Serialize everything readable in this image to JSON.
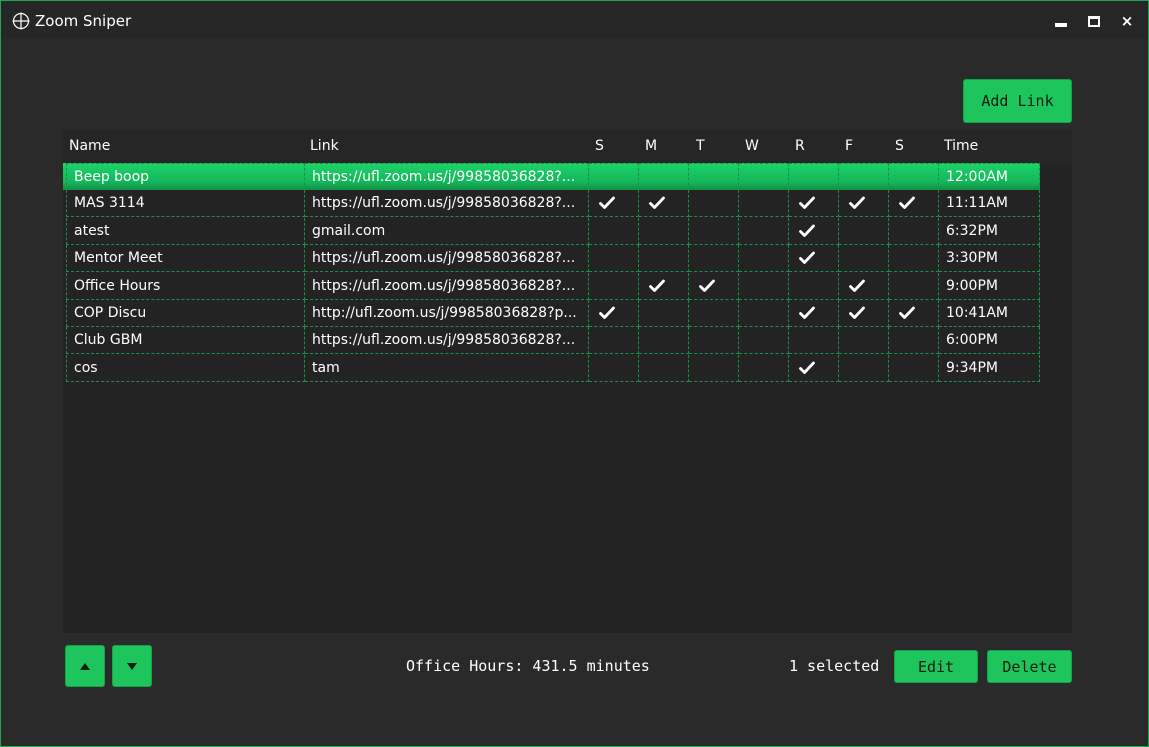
{
  "window": {
    "title": "Zoom Sniper",
    "app_icon": "crosshair-icon",
    "controls": {
      "minimize": "minimize-icon",
      "maximize": "maximize-icon",
      "close": "×"
    },
    "accent_color": "#1ec45c"
  },
  "toolbar": {
    "add_link_label": "Add Link"
  },
  "table": {
    "columns": [
      "Name",
      "Link",
      "S",
      "M",
      "T",
      "W",
      "R",
      "F",
      "S",
      "Time"
    ],
    "rows": [
      {
        "name": "Beep boop",
        "link": "https://ufl.zoom.us/j/99858036828?...",
        "days": [
          false,
          false,
          false,
          false,
          false,
          false,
          false
        ],
        "time": "12:00AM",
        "selected": true
      },
      {
        "name": "MAS 3114",
        "link": "https://ufl.zoom.us/j/99858036828?...",
        "days": [
          true,
          true,
          false,
          false,
          true,
          true,
          true
        ],
        "time": "11:11AM",
        "selected": false
      },
      {
        "name": "atest",
        "link": "gmail.com",
        "days": [
          false,
          false,
          false,
          false,
          true,
          false,
          false
        ],
        "time": "6:32PM",
        "selected": false
      },
      {
        "name": "Mentor Meet",
        "link": "https://ufl.zoom.us/j/99858036828?...",
        "days": [
          false,
          false,
          false,
          false,
          true,
          false,
          false
        ],
        "time": "3:30PM",
        "selected": false
      },
      {
        "name": "Office Hours",
        "link": "https://ufl.zoom.us/j/99858036828?...",
        "days": [
          false,
          true,
          true,
          false,
          false,
          true,
          false
        ],
        "time": "9:00PM",
        "selected": false
      },
      {
        "name": "COP Discu",
        "link": "http://ufl.zoom.us/j/99858036828?p...",
        "days": [
          true,
          false,
          false,
          false,
          true,
          true,
          true
        ],
        "time": "10:41AM",
        "selected": false
      },
      {
        "name": "Club GBM",
        "link": "https://ufl.zoom.us/j/99858036828?...",
        "days": [
          false,
          false,
          false,
          false,
          false,
          false,
          false
        ],
        "time": "6:00PM",
        "selected": false
      },
      {
        "name": "cos",
        "link": "tam",
        "days": [
          false,
          false,
          false,
          false,
          true,
          false,
          false
        ],
        "time": "9:34PM",
        "selected": false
      }
    ]
  },
  "footer": {
    "move_up_icon": "triangle-up-icon",
    "move_down_icon": "triangle-down-icon",
    "status": "Office Hours: 431.5 minutes",
    "selected_count": "1 selected",
    "edit_label": "Edit",
    "delete_label": "Delete"
  }
}
